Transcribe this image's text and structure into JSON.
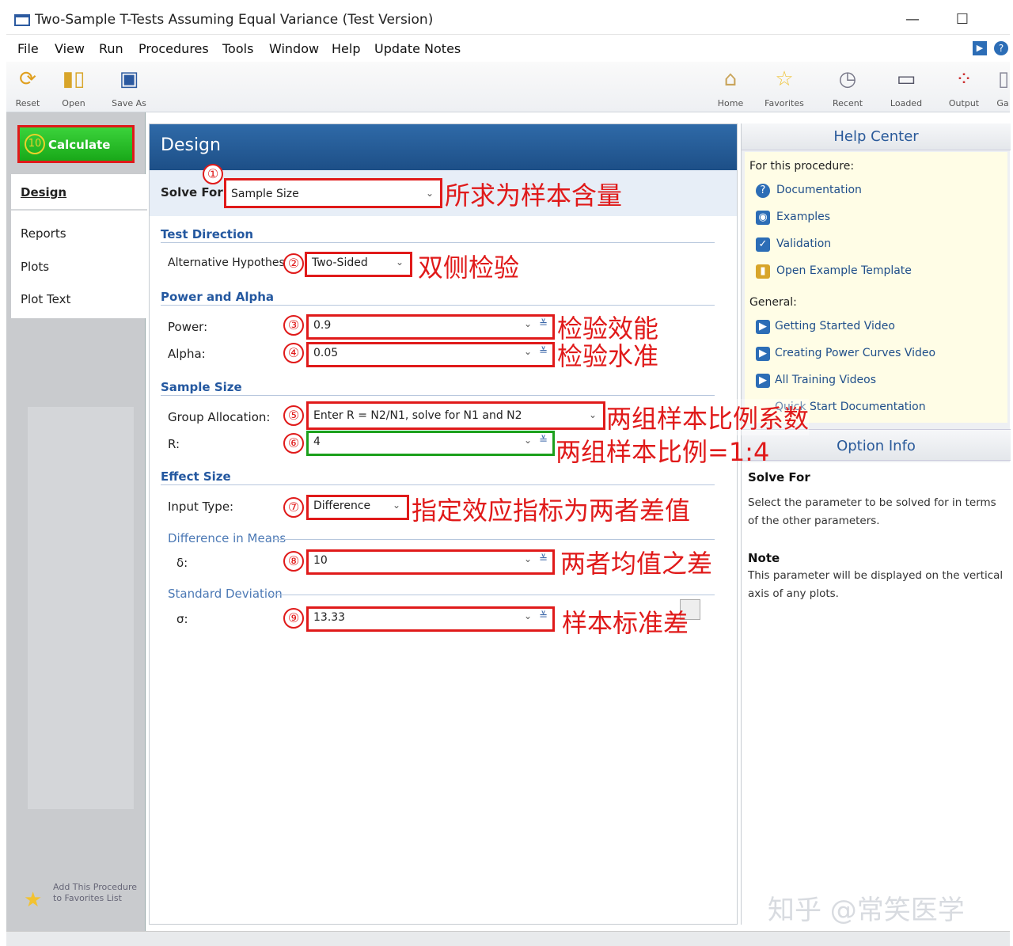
{
  "window": {
    "title": "Two-Sample T-Tests Assuming Equal Variance (Test Version)",
    "minimize": "—",
    "maximize": "☐"
  },
  "menu": [
    "File",
    "View",
    "Run",
    "Procedures",
    "Tools",
    "Window",
    "Help",
    "Update Notes"
  ],
  "toolbar": {
    "left": [
      {
        "label": "Reset",
        "icon": "reset-icon"
      },
      {
        "label": "Open",
        "icon": "open-icon"
      },
      {
        "label": "Save As",
        "icon": "save-icon"
      }
    ],
    "right": [
      {
        "label": "Home",
        "icon": "home-icon"
      },
      {
        "label": "Favorites",
        "icon": "star-icon"
      },
      {
        "label": "Recent",
        "icon": "clock-icon"
      },
      {
        "label": "Loaded",
        "icon": "windows-icon"
      },
      {
        "label": "Output",
        "icon": "output-icon"
      },
      {
        "label": "Ga",
        "icon": "gallery-icon"
      }
    ]
  },
  "left": {
    "calculate": "Calculate",
    "calculate_num": "10",
    "nav": [
      "Design",
      "Reports",
      "Plots",
      "Plot Text"
    ],
    "add_fav": "Add This Procedure to Favorites List"
  },
  "design": {
    "header": "Design",
    "solve_for_label": "Solve For:",
    "solve_for_value": "Sample Size",
    "sections": {
      "test_direction": "Test Direction",
      "power_alpha": "Power and Alpha",
      "sample_size": "Sample Size",
      "effect_size": "Effect Size"
    },
    "alt_hyp_label": "Alternative Hypothesis:",
    "alt_hyp_value": "Two-Sided",
    "power_label": "Power:",
    "power_value": "0.9",
    "alpha_label": "Alpha:",
    "alpha_value": "0.05",
    "group_alloc_label": "Group Allocation:",
    "group_alloc_value": "Enter R = N2/N1, solve for N1 and N2",
    "r_label": "R:",
    "r_value": "4",
    "input_type_label": "Input Type:",
    "input_type_value": "Difference",
    "diff_means": "Difference in Means",
    "delta_label": "δ:",
    "delta_value": "10",
    "std_dev": "Standard Deviation",
    "sigma_label": "σ:",
    "sigma_value": "13.33"
  },
  "annotations": {
    "n1": "①",
    "n2": "②",
    "n3": "③",
    "n4": "④",
    "n5": "⑤",
    "n6": "⑥",
    "n7": "⑦",
    "n8": "⑧",
    "n9": "⑨",
    "a1": "所求为样本含量",
    "a2": "双侧检验",
    "a3": "检验效能",
    "a4": "检验水准",
    "a5": "两组样本比例系数",
    "a6": "两组样本比例=1:4",
    "a7": "指定效应指标为两者差值",
    "a8": "两者均值之差",
    "a9": "样本标准差"
  },
  "help": {
    "header": "Help Center",
    "for_this": "For this procedure:",
    "proc_links": [
      "Documentation",
      "Examples",
      "Validation",
      "Open Example Template"
    ],
    "general": "General:",
    "general_links": [
      "Getting Started Video",
      "Creating Power Curves Video",
      "All Training Videos",
      "Quick Start Documentation"
    ]
  },
  "option_info": {
    "header": "Option Info",
    "solve_for_title": "Solve For",
    "solve_for_text": "Select the parameter to be solved for in terms of the other parameters.",
    "note_title": "Note",
    "note_text": "This parameter will be displayed on the vertical axis of any plots."
  },
  "watermark": "知乎 @常笑医学",
  "colors": {
    "accent": "#1d4f87",
    "calculate": "#19a819",
    "annotation": "#e01a1a",
    "highlight_green": "#1ca01c"
  }
}
